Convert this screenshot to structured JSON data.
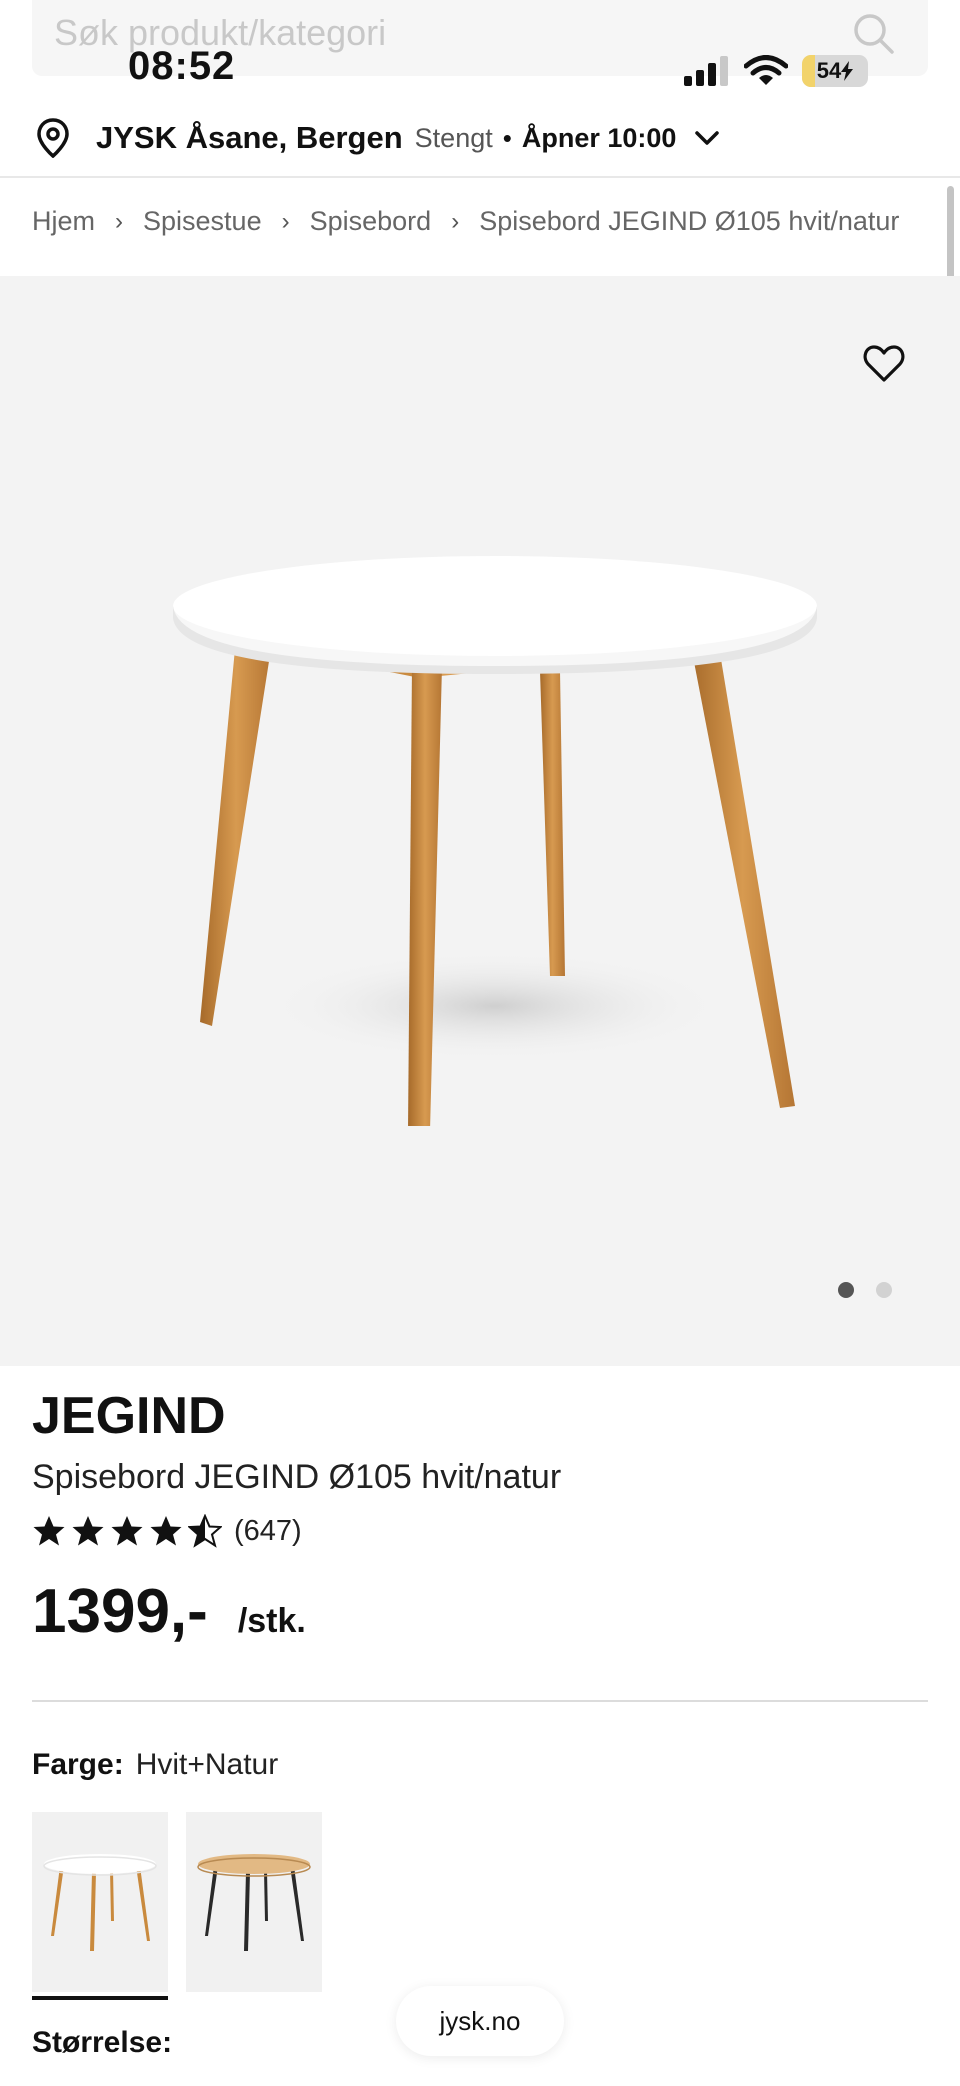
{
  "search": {
    "placeholder": "Søk produkt/kategori"
  },
  "status_bar": {
    "time": "08:52",
    "battery": "54"
  },
  "store": {
    "name": "JYSK Åsane, Bergen",
    "status": "Stengt",
    "separator": "•",
    "opens": "Åpner 10:00"
  },
  "breadcrumb": {
    "items": [
      "Hjem",
      "Spisestue",
      "Spisebord",
      "Spisebord JEGIND Ø105 hvit/natur"
    ],
    "separator": "›"
  },
  "gallery": {
    "image_count": 2,
    "active_index": 0
  },
  "product": {
    "brand": "JEGIND",
    "title": "Spisebord JEGIND Ø105 hvit/natur",
    "rating": 4.5,
    "review_count": "(647)",
    "price": "1399,-",
    "unit": "/stk."
  },
  "options": {
    "color_label": "Farge:",
    "color_value": "Hvit+Natur",
    "swatches": [
      "Hvit+Natur",
      "Natur+Svart"
    ],
    "selected_swatch": 0,
    "size_label": "Størrelse:"
  },
  "browser": {
    "domain": "jysk.no"
  },
  "colors": {
    "star": "#111111",
    "gallery_bg": "#f3f3f3",
    "wood": "#c98a3e"
  }
}
